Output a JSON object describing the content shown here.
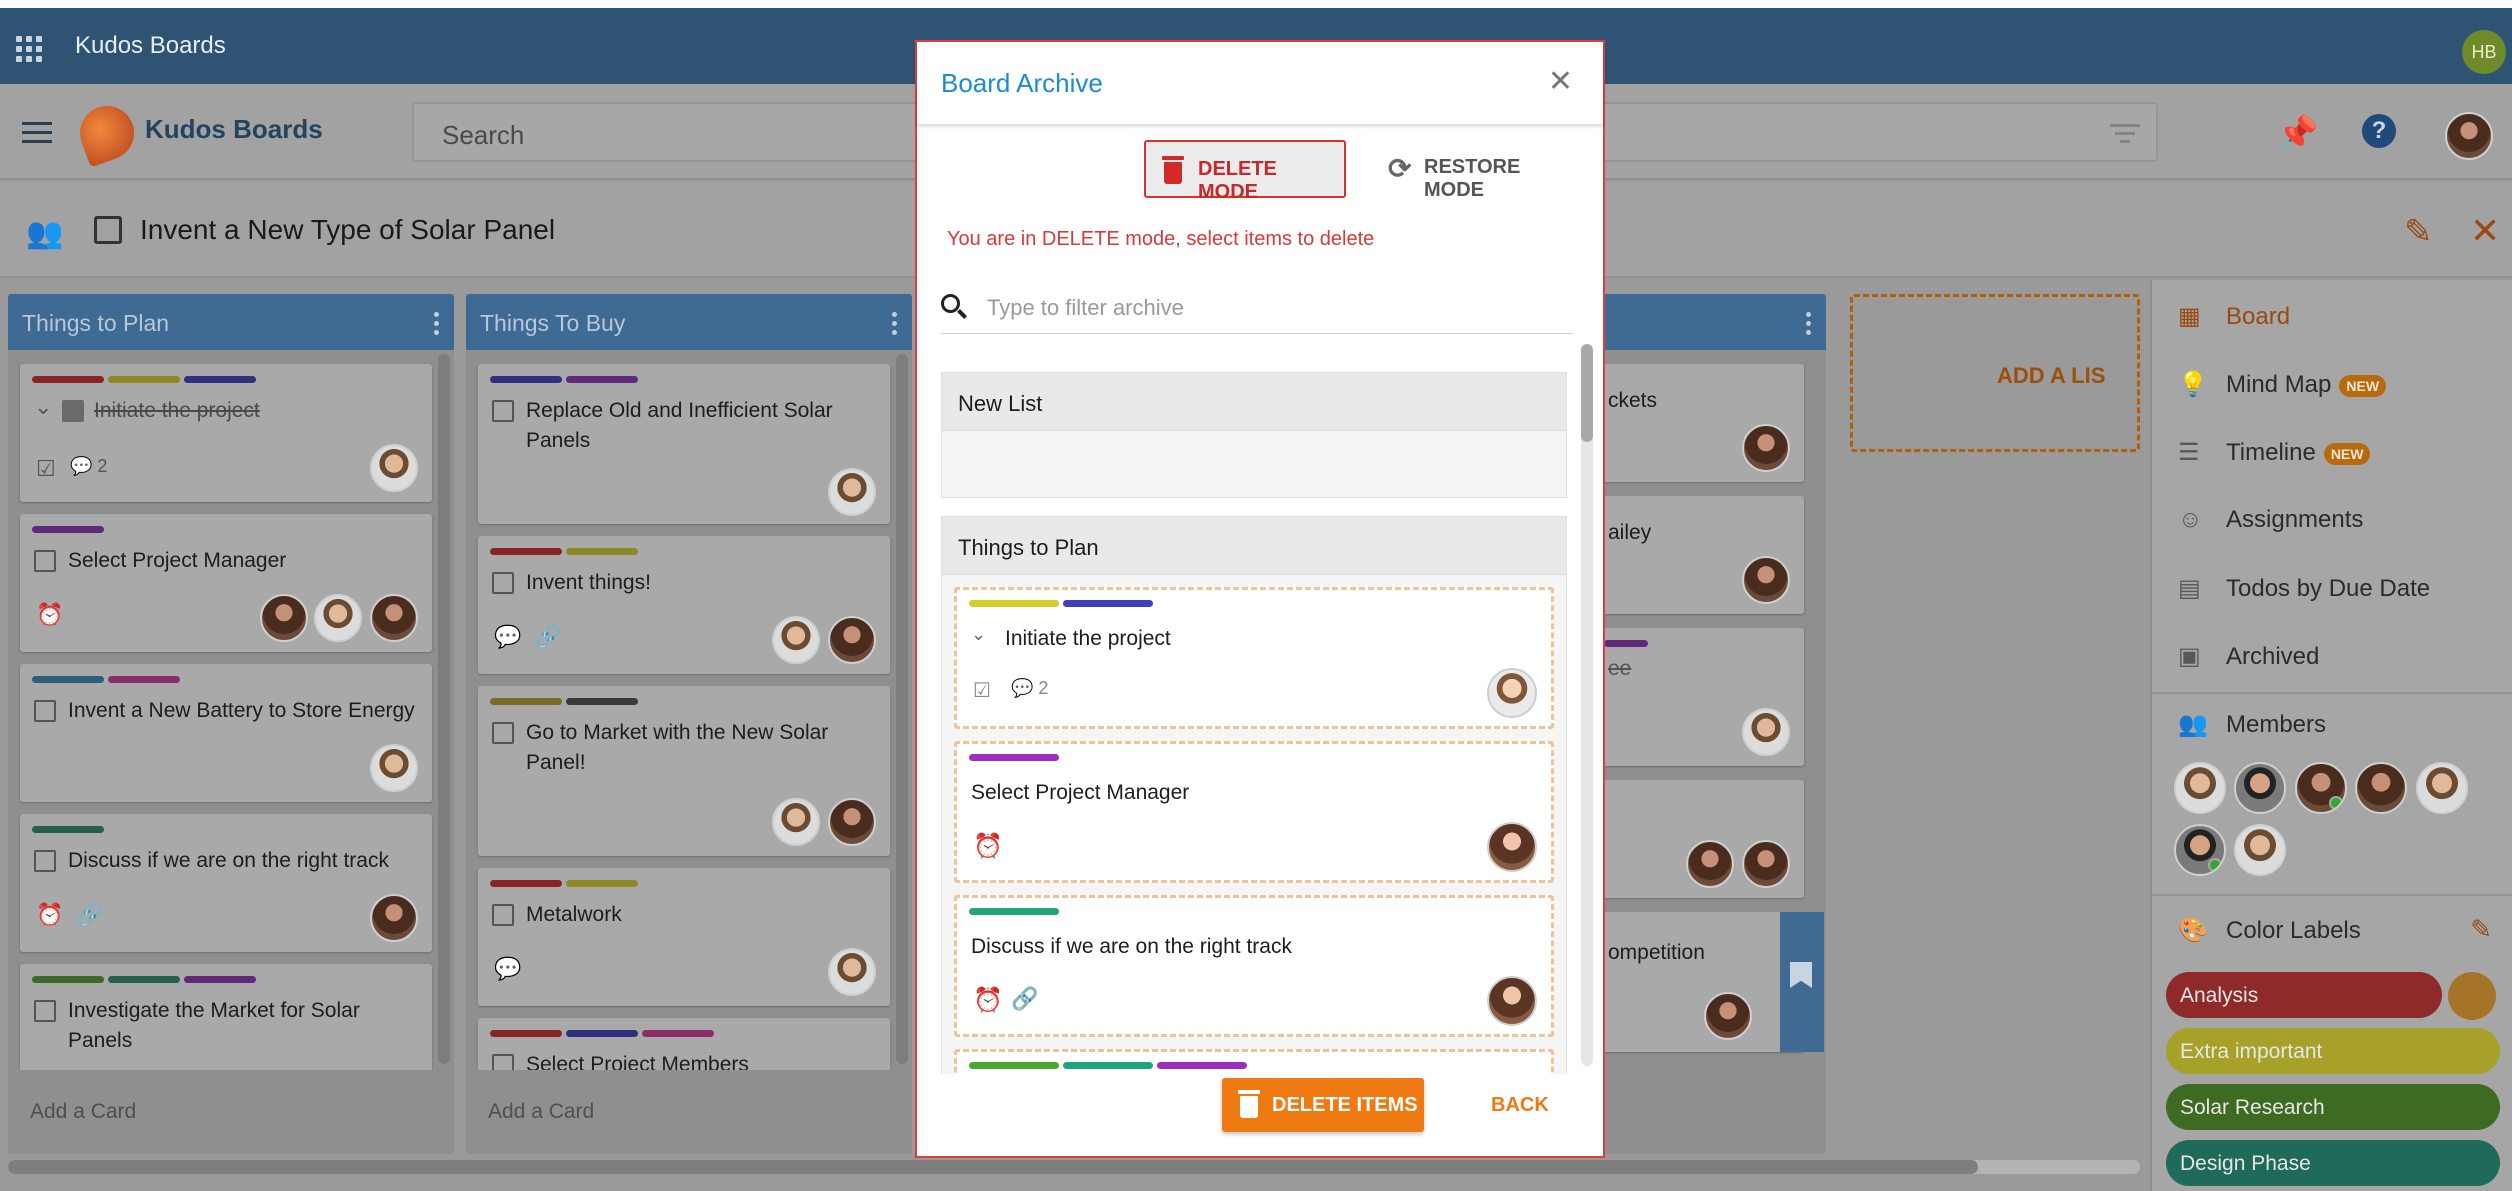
{
  "topbar": {
    "title": "Kudos Boards",
    "user_initials": "HB"
  },
  "appbar": {
    "app_name": "Kudos Boards",
    "search_placeholder": "Search"
  },
  "board": {
    "title": "Invent a New Type of Solar Panel"
  },
  "lists": [
    {
      "title": "Things to Plan",
      "add_card": "Add a Card",
      "cards": [
        {
          "title": "Initiate the project",
          "completed": true,
          "comments": "2"
        },
        {
          "title": "Select Project Manager"
        },
        {
          "title": "Invent a New Battery to Store Energy"
        },
        {
          "title": "Discuss if we are on the right track"
        },
        {
          "title": "Investigate the Market for Solar Panels"
        }
      ]
    },
    {
      "title": "Things To Buy",
      "add_card": "Add a Card",
      "cards": [
        {
          "title": "Replace Old and Inefficient Solar Panels"
        },
        {
          "title": "Invent things!"
        },
        {
          "title": "Go to Market with the New Solar Panel!"
        },
        {
          "title": "Metalwork"
        },
        {
          "title": "Select Project Members"
        }
      ]
    },
    {
      "title": "",
      "cards": [
        {
          "title": "ckets"
        },
        {
          "title": "ailey"
        },
        {
          "title": "ee"
        },
        {
          "title": ""
        },
        {
          "title": "ompetition"
        }
      ]
    }
  ],
  "add_list_label": "ADD A LIS",
  "sidebar": {
    "items": [
      {
        "label": "Board",
        "icon": "board-icon",
        "active": true
      },
      {
        "label": "Mind Map",
        "icon": "lightbulb-icon",
        "badge": "NEW"
      },
      {
        "label": "Timeline",
        "icon": "timeline-icon",
        "badge": "NEW"
      },
      {
        "label": "Assignments",
        "icon": "face-icon"
      },
      {
        "label": "Todos by Due Date",
        "icon": "calendar-icon"
      },
      {
        "label": "Archived",
        "icon": "archive-icon"
      }
    ],
    "members_label": "Members",
    "color_labels_title": "Color Labels",
    "color_labels": [
      {
        "name": "Analysis",
        "color": "#8f2a2a"
      },
      {
        "name": "Extra important",
        "color": "#a7a12a"
      },
      {
        "name": "Solar Research",
        "color": "#3f6a22"
      },
      {
        "name": "Design Phase",
        "color": "#1f6a58"
      }
    ]
  },
  "modal": {
    "title": "Board Archive",
    "delete_mode": "DELETE MODE",
    "restore_mode": "RESTORE MODE",
    "hint": "You are in DELETE mode, select items to delete",
    "filter_placeholder": "Type to filter archive",
    "archived_lists": [
      {
        "title": "New List"
      },
      {
        "title": "Things to Plan",
        "cards": [
          {
            "title": "Initiate the project",
            "comments": "2",
            "labels": [
              "#d2cd27",
              "#3f3fbf"
            ]
          },
          {
            "title": "Select Project Manager",
            "labels": [
              "#9b2fc0"
            ]
          },
          {
            "title": "Discuss if we are on the right track",
            "labels": [
              "#1fa67a"
            ]
          },
          {
            "title": "",
            "labels": [
              "#4aa832",
              "#1fa67a",
              "#9b2fc0"
            ]
          }
        ]
      }
    ],
    "delete_items": "DELETE ITEMS",
    "back": "BACK"
  },
  "colors": {
    "topbar": "#2f5473",
    "accent_orange": "#f07a12",
    "danger_red": "#d93030",
    "modal_title_blue": "#1e8bd1",
    "list_header_blue": "#3f6a93"
  }
}
